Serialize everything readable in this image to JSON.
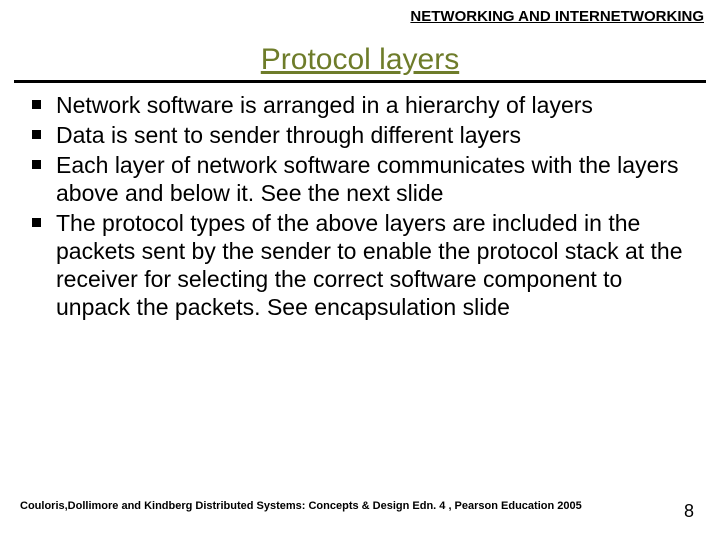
{
  "header": "NETWORKING AND INTERNETWORKING",
  "title": "Protocol layers",
  "bullets": [
    "Network software is arranged in a hierarchy of layers",
    "Data is sent to sender through different layers",
    "Each layer of network software communicates with the layers above and below it. See the next slide",
    "The protocol types of the above layers are included in the packets sent by the sender  to enable the protocol stack at the receiver for selecting the correct software component to unpack the packets. See encapsulation slide"
  ],
  "footer": "Couloris,Dollimore and Kindberg  Distributed Systems: Concepts & Design  Edn. 4 , Pearson Education 2005",
  "page_number": "8"
}
